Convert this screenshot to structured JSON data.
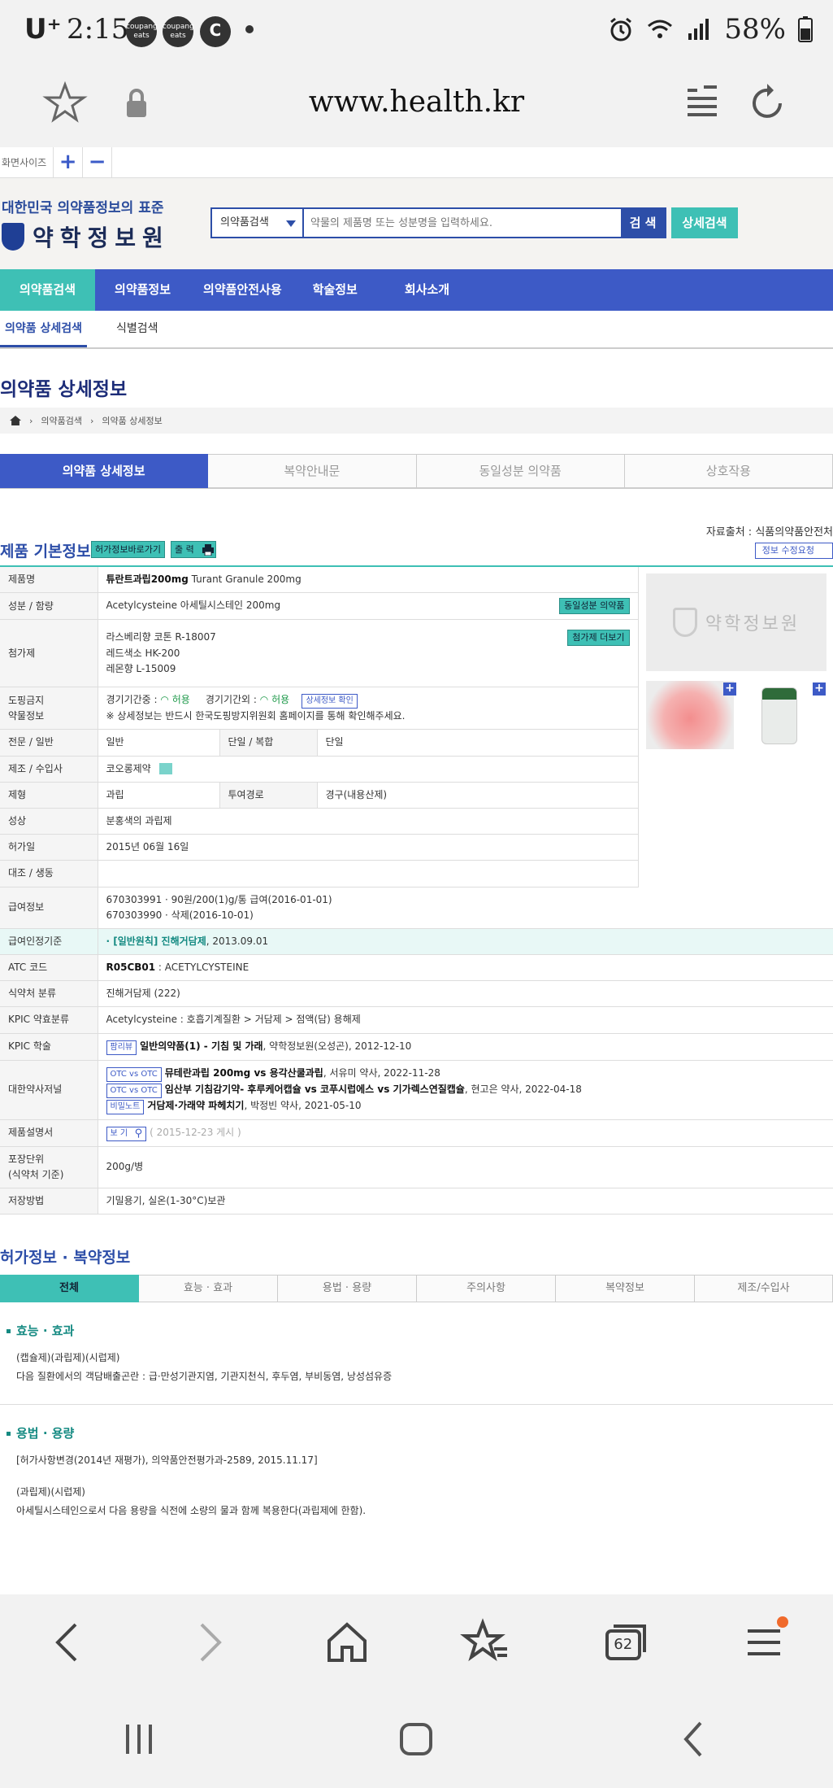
{
  "status": {
    "carrier": "U⁺",
    "time": "2:15",
    "app1": "coupang eats",
    "app2": "coupang eats",
    "app3": "C",
    "battery": "58%"
  },
  "browser": {
    "url": "www.health.kr",
    "tab_count": "62"
  },
  "fontbar": {
    "label": "화면사이즈",
    "plus": "+",
    "minus": "−"
  },
  "header": {
    "slogan": "대한민국 의약품정보의 표준",
    "logo": "약학정보원",
    "search_select": "의약품검색",
    "search_placeholder": "약물의 제품명 또는 성분명을 입력하세요.",
    "search_button": "검 색",
    "detail_button": "상세검색"
  },
  "gnb": [
    "의약품검색",
    "의약품정보",
    "의약품안전사용",
    "학술정보",
    "회사소개"
  ],
  "snb": [
    "의약품 상세검색",
    "식별검색"
  ],
  "page_title": "의약품 상세정보",
  "breadcrumb": [
    "의약품검색",
    "의약품 상세정보"
  ],
  "main_tabs": [
    "의약품 상세정보",
    "복약안내문",
    "동일성분 의약품",
    "상호작용"
  ],
  "source": "자료출처 : 식품의약품안전처",
  "section_basic": {
    "title": "제품 기본정보",
    "link_btn": "허가정보바로가기",
    "print_btn": "출 력",
    "edit_btn": "정보 수정요청"
  },
  "info": {
    "name_label": "제품명",
    "name_ko": "튜란트과립200mg",
    "name_en": "Turant Granule 200mg",
    "ingredient_label": "성분 / 함량",
    "ingredient": "Acetylcysteine   아세틸시스테인   200mg",
    "same_ingredient_btn": "동일성분 의약품",
    "additive_label": "첨가제",
    "additives": [
      "라스베리향 코톤 R-18007",
      "레드색소 HK-200",
      "레몬향 L-15009"
    ],
    "additive_btn": "첨가제 더보기",
    "doping_label_1": "도핑금지",
    "doping_label_2": "약물정보",
    "doping_in": "경기기간중 :",
    "doping_in_val": "허용",
    "doping_out": "경기기간외 :",
    "doping_out_val": "허용",
    "doping_btn": "상세정보 확인",
    "doping_note": "※ 상세정보는 반드시 한국도핑방지위원회 홈페이지를 통해 확인해주세요.",
    "class_label": "전문 / 일반",
    "class_val": "일반",
    "single_label": "단일 / 복합",
    "single_val": "단일",
    "maker_label": "제조 / 수입사",
    "maker_val": "코오롱제약",
    "form_label": "제형",
    "form_val": "과립",
    "route_label": "투여경로",
    "route_val": "경구(내용산제)",
    "appearance_label": "성상",
    "appearance_val": "분홍색의 과립제",
    "approval_label": "허가일",
    "approval_val": "2015년 06월 16일",
    "ref_label": "대조 / 생동",
    "ref_val": "",
    "insurance_label": "급여정보",
    "insurance_1": "670303991 · 90원/200(1)g/통 급여(2016-01-01)",
    "insurance_2": "670303990 · 삭제(2016-10-01)",
    "criteria_label": "급여인정기준",
    "criteria_val": "· [일반원칙] 진해거담제",
    "criteria_date": ", 2013.09.01",
    "atc_label": "ATC 코드",
    "atc_code": "R05CB01",
    "atc_name": " : ACETYLCYSTEINE",
    "mfds_label": "식약처 분류",
    "mfds_val": "진해거담제 (222)",
    "kpic_label": "KPIC 약효분류",
    "kpic_val": "Acetylcysteine : 호흡기계질환 > 거담제 > 점액(담) 용해제",
    "kpic_study_label": "KPIC 학술",
    "kpic_study_tag": "팜리뷰",
    "kpic_study_title": "일반의약품(1) - 기침 및 가래",
    "kpic_study_src": ", 약학정보원(오성곤), 2012-12-10",
    "journal_label": "대한약사저널",
    "journal": [
      {
        "tag": "OTC vs OTC",
        "title": "뮤테란과립 200mg vs 용각산쿨과립",
        "src": ", 서유미 약사, 2022-11-28"
      },
      {
        "tag": "OTC vs OTC",
        "title": "임산부 기침감기약- 후루케어캡슐 vs 코푸시럽에스 vs 기가렉스연질캡슐",
        "src": ", 현고은 약사, 2022-04-18"
      },
      {
        "tag": "비밀노트",
        "title": "거담제·가래약 파헤치기",
        "src": ", 박정빈 약사, 2021-05-10"
      }
    ],
    "leaflet_label": "제품설명서",
    "leaflet_btn": "보 기",
    "leaflet_date": "( 2015-12-23 게시 )",
    "package_label_1": "포장단위",
    "package_label_2": "(식약처 기준)",
    "package_val": "200g/병",
    "storage_label": "저장방법",
    "storage_val": "기밀용기, 실온(1-30°C)보관"
  },
  "side_logo": "약학정보원",
  "section_license": {
    "title": "허가정보 · 복약정보",
    "tabs": [
      "전체",
      "효능 · 효과",
      "용법 · 용량",
      "주의사항",
      "복약정보",
      "제조/수입사"
    ],
    "effect_title": "효능 · 효과",
    "effect_1": "(캡슐제)(과립제)(시럽제)",
    "effect_2": "다음 질환에서의 객담배출곤란 : 급·만성기관지염, 기관지천식, 후두염, 부비동염, 낭성섬유증",
    "dosage_title": "용법 · 용량",
    "dosage_1": "[허가사항변경(2014년 재평가), 의약품안전평가과-2589, 2015.11.17]",
    "dosage_2": "(과립제)(시럽제)",
    "dosage_3": "아세틸시스테인으로서 다음 용량을 식전에 소량의 물과 함께 복용한다(과립제에 한함)."
  },
  "icons": {
    "bookmark": "star-icon",
    "lock": "lock-icon",
    "reader": "reader-icon",
    "reload": "reload-icon",
    "back": "back-icon",
    "forward": "forward-icon",
    "home": "home-icon",
    "bookmarks": "bookmarks-icon",
    "tabs": "tabs-icon",
    "menu": "menu-icon"
  },
  "colors": {
    "primary": "#3d5ac6",
    "accent": "#3ec0b5",
    "title": "#1c2c78"
  }
}
